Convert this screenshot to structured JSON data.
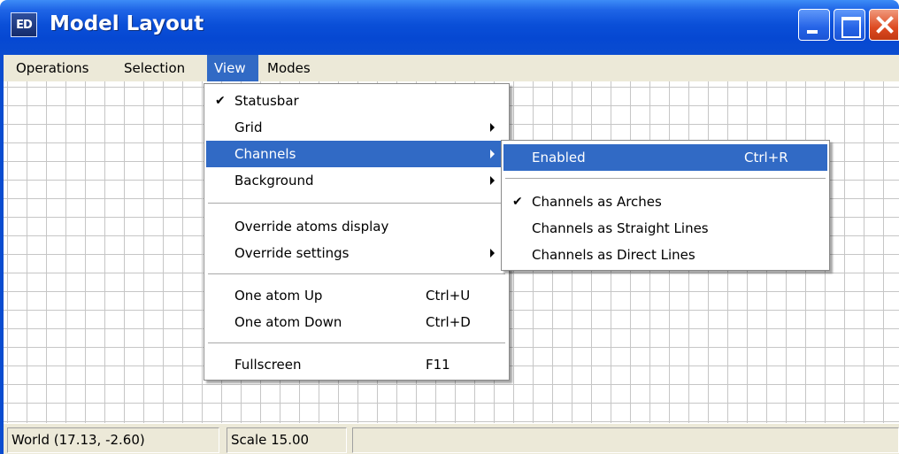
{
  "window": {
    "title": "Model Layout",
    "icon_text": "ED",
    "icon": "app-icon",
    "controls": [
      "minimize-icon",
      "maximize-icon",
      "close-icon"
    ]
  },
  "menubar": {
    "items": [
      "Operations",
      "Selection",
      "View",
      "Modes"
    ],
    "active": "View"
  },
  "view_menu": {
    "items": [
      {
        "label": "Statusbar",
        "checked": true
      },
      {
        "label": "Grid",
        "submenu": true
      },
      {
        "label": "Channels",
        "submenu": true,
        "highlighted": true
      },
      {
        "label": "Background",
        "submenu": true
      },
      {
        "label": "Override atoms display"
      },
      {
        "label": "Override settings",
        "submenu": true
      },
      {
        "label": "One atom Up",
        "shortcut": "Ctrl+U"
      },
      {
        "label": "One atom Down",
        "shortcut": "Ctrl+D"
      },
      {
        "label": "Fullscreen",
        "shortcut": "F11"
      }
    ]
  },
  "channels_submenu": {
    "items": [
      {
        "label": "Enabled",
        "shortcut": "Ctrl+R",
        "highlighted": true
      },
      {
        "label": "Channels as Arches",
        "checked": true
      },
      {
        "label": "Channels as Straight Lines"
      },
      {
        "label": "Channels as Direct Lines"
      }
    ]
  },
  "statusbar": {
    "world": "World (17.13, -2.60)",
    "scale": "Scale 15.00",
    "extra": ""
  },
  "colors": {
    "titlebar": "#0a4cd0",
    "highlight": "#316ac5",
    "menubar": "#ece9d8"
  }
}
